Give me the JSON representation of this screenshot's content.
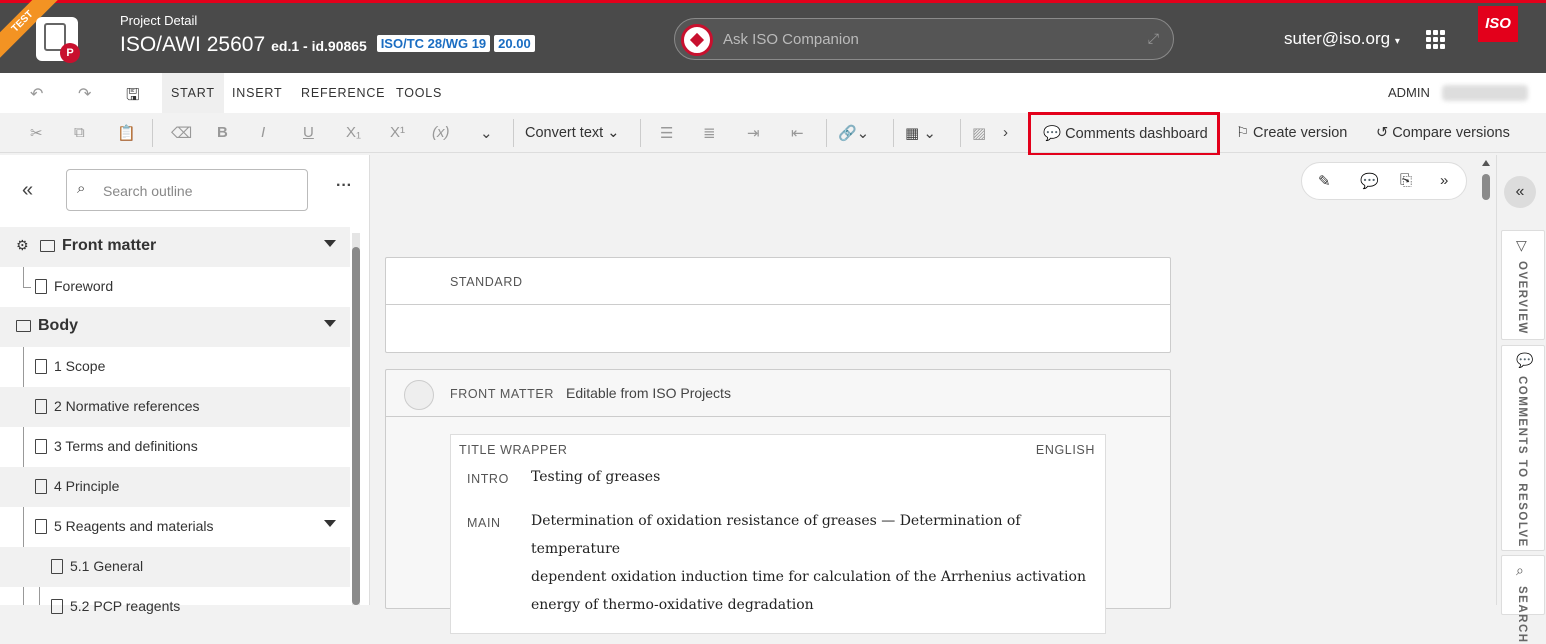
{
  "header": {
    "test_label": "TEST",
    "app_badge": "P",
    "project_label": "Project Detail",
    "project_id": "ISO/AWI 25607",
    "edition": "ed.1 - id.90865",
    "committee": "ISO/TC 28/WG 19",
    "stage": "20.00",
    "ask_placeholder": "Ask ISO Companion",
    "user": "suter@iso.org",
    "iso_logo": "ISO"
  },
  "tabs": {
    "start": "START",
    "insert": "INSERT",
    "reference": "REFERENCE",
    "tools": "TOOLS",
    "admin": "ADMIN"
  },
  "toolbar": {
    "convert_text": "Convert text",
    "comments_dashboard": "Comments dashboard",
    "create_version": "Create version",
    "compare_versions": "Compare versions"
  },
  "outline": {
    "search_placeholder": "Search outline",
    "front_matter": "Front matter",
    "foreword": "Foreword",
    "body": "Body",
    "items": [
      "1 Scope",
      "2 Normative references",
      "3 Terms and definitions",
      "4 Principle",
      "5 Reagents and materials"
    ],
    "sub_items": [
      "5.1 General",
      "5.2 PCP reagents"
    ]
  },
  "document": {
    "standard_label": "STANDARD",
    "front_matter_label": "FRONT MATTER",
    "front_matter_note": "Editable from ISO Projects",
    "title_wrapper_label": "TITLE WRAPPER",
    "language": "ENGLISH",
    "intro_label": "INTRO",
    "intro_text": "Testing of greases",
    "main_label": "MAIN",
    "main_line1": "Determination of oxidation resistance of greases — Determination of temperature",
    "main_line2": "dependent oxidation induction time for calculation of the Arrhenius activation",
    "main_line3": "energy of thermo-oxidative degradation"
  },
  "right_rail": {
    "overview": "OVERVIEW",
    "comments_to_resolve": "COMMENTS TO RESOLVE",
    "search": "SEARCH"
  },
  "colors": {
    "accent_red": "#e3001b",
    "header_bg": "#4a4a4a",
    "chip_blue": "#1a6dc2",
    "test_orange": "#f39323"
  }
}
